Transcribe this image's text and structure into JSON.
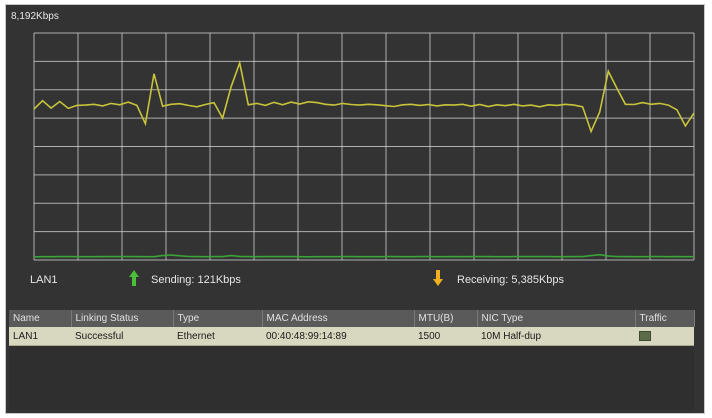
{
  "graph": {
    "max_label": "8,192Kbps",
    "colors": {
      "grid": "#cfcfcf",
      "receiving_line": "#c8c43a",
      "sending_line": "#3aa43a",
      "background": "#333333"
    },
    "receiving_trace_kbps": [
      5450,
      5750,
      5480,
      5720,
      5470,
      5580,
      5590,
      5620,
      5560,
      5650,
      5600,
      5700,
      5580,
      4920,
      6720,
      5550,
      5620,
      5640,
      5580,
      5530,
      5610,
      5680,
      5120,
      6250,
      7110,
      5600,
      5650,
      5580,
      5690,
      5600,
      5700,
      5630,
      5710,
      5680,
      5620,
      5590,
      5650,
      5610,
      5590,
      5620,
      5600,
      5570,
      5540,
      5600,
      5620,
      5580,
      5610,
      5560,
      5600,
      5590,
      5620,
      5550,
      5610,
      5540,
      5600,
      5570,
      5620,
      5560,
      5590,
      5530,
      5600,
      5580,
      5620,
      5590,
      5530,
      4640,
      5340,
      6810,
      6200,
      5620,
      5610,
      5680,
      5620,
      5650,
      5590,
      5420,
      4840,
      5310
    ],
    "sending_trace_kbps": [
      115,
      118,
      120,
      122,
      121,
      119,
      118,
      120,
      121,
      123,
      125,
      124,
      121,
      118,
      120,
      160,
      180,
      150,
      130,
      122,
      120,
      121,
      124,
      160,
      130,
      122,
      119,
      121,
      123,
      124,
      122,
      119,
      117,
      120,
      118,
      120,
      122,
      121,
      120,
      119,
      120,
      122,
      121,
      120,
      118,
      121,
      122,
      120,
      119,
      121,
      120,
      123,
      122,
      121,
      120,
      119,
      121,
      122,
      124,
      122,
      121,
      120,
      119,
      121,
      124,
      160,
      190,
      140,
      122,
      121,
      120,
      119,
      121,
      122,
      120,
      121,
      118,
      120
    ]
  },
  "legend": {
    "lan_label": "LAN1",
    "sending": "Sending: 121Kbps",
    "receiving": "Receiving: 5,385Kbps",
    "send_arrow_color": "#4bbf3a",
    "recv_arrow_color": "#f0b020"
  },
  "table": {
    "headers": [
      "Name",
      "Linking Status",
      "Type",
      "MAC Address",
      "MTU(B)",
      "NIC Type",
      "Traffic"
    ],
    "rows": [
      {
        "name": "LAN1",
        "status": "Successful",
        "type": "Ethernet",
        "mac": "00:40:48:99:14:89",
        "mtu": "1500",
        "nic_type": "10M Half-dup",
        "traffic_icon": "traffic-graph-icon"
      }
    ]
  }
}
